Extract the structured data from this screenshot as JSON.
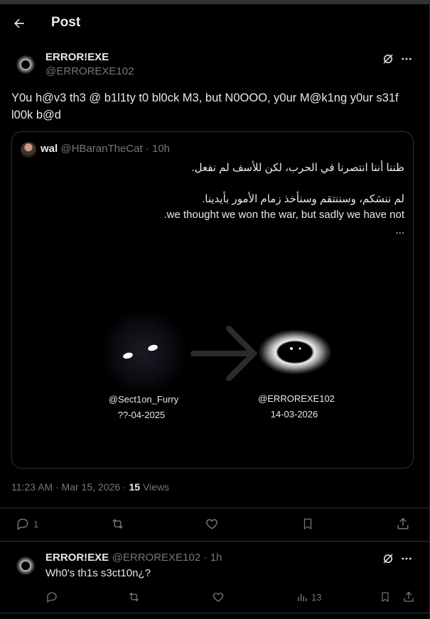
{
  "header": {
    "title": "Post"
  },
  "post": {
    "name": "ERROR!EXE",
    "handle": "@ERROREXE102",
    "text": "Y0u h@v3 th3  @ b1l1ty t0 bl0ck M3, but N0OOO, y0ur M@k1ng y0ur s31f l00k b@d",
    "quote": {
      "name": "wal",
      "handle": "@HBaranTheCat",
      "time": "· 10h",
      "line1": "ظننا أننا انتصرنا في الحرب، لكن للأسف لم نفعل.",
      "line2": "لم ننسَكم، وسننتقم وسنأخذ زمام الأمور بأيدينا.",
      "line3": ".we thought we won the war, but sadly we have not",
      "more": "...",
      "media": {
        "left_handle": "@Sect1on_Furry",
        "left_date": "??-04-2025",
        "right_handle": "@ERROREXE102",
        "right_date": "14-03-2026"
      }
    },
    "timestamp": "11:23 AM · Mar 15, 2026 ·",
    "views_count": "15",
    "views_label": "Views",
    "reply_count": "1"
  },
  "reply": {
    "name": "ERROR!EXE",
    "handle": "@ERROREXE102",
    "time": "· 1h",
    "text": "Wh0's th1s s3ct10n¿?",
    "views": "13"
  }
}
